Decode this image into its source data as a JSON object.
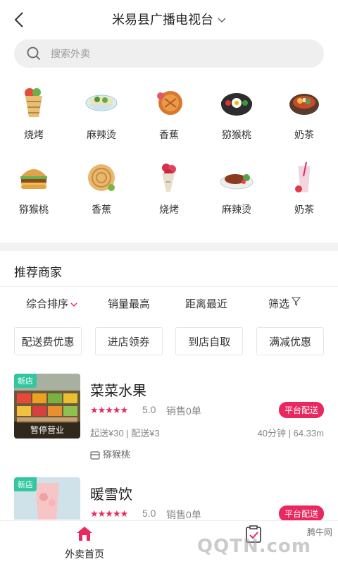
{
  "header": {
    "back_icon": "chevron-left-icon",
    "title": "米易县广播电视台",
    "dropdown_icon": "chevron-down-icon"
  },
  "search": {
    "placeholder": "搜索外卖",
    "icon": "search-icon"
  },
  "categories": [
    {
      "label": "烧烤",
      "icon": "wrap-food-icon"
    },
    {
      "label": "麻辣烫",
      "icon": "noodle-bowl-icon"
    },
    {
      "label": "香蕉",
      "icon": "pie-icon"
    },
    {
      "label": "猕猴桃",
      "icon": "hotpot-icon"
    },
    {
      "label": "奶茶",
      "icon": "stew-pot-icon"
    },
    {
      "label": "猕猴桃",
      "icon": "burger-icon"
    },
    {
      "label": "香蕉",
      "icon": "pancake-icon"
    },
    {
      "label": "烧烤",
      "icon": "flower-bouquet-icon"
    },
    {
      "label": "麻辣烫",
      "icon": "steak-icon"
    },
    {
      "label": "奶茶",
      "icon": "milkshake-icon"
    }
  ],
  "recommend": {
    "title": "推荐商家"
  },
  "sort": {
    "items": [
      "综合排序",
      "销量最高",
      "距离最近",
      "筛选"
    ],
    "active_color": "#e8285e"
  },
  "chips": [
    "配送费优惠",
    "进店领券",
    "到店自取",
    "满减优惠"
  ],
  "shops": [
    {
      "badge": "新店",
      "status": "暂停营业",
      "name": "菜菜水果",
      "stars": "★★★★★",
      "rating": "5.0",
      "sales": "销售0单",
      "delivery_tag": "平台配送",
      "meta": "起送¥30 | 配送¥3",
      "distance": "40分钟 | 64.33m",
      "tag": "猕猴桃"
    },
    {
      "badge": "新店",
      "name": "暖雪饮",
      "stars": "★★★★★",
      "rating": "5.0",
      "sales": "销售0单",
      "delivery_tag": "平台配送"
    }
  ],
  "bottom_nav": {
    "home_label": "外卖首页",
    "home_icon": "home-icon",
    "order_icon": "order-check-icon"
  },
  "watermark": {
    "small": "腾牛网",
    "big": "QQTN.com"
  },
  "colors": {
    "accent": "#e8285e",
    "new_badge": "#32c7a1"
  }
}
